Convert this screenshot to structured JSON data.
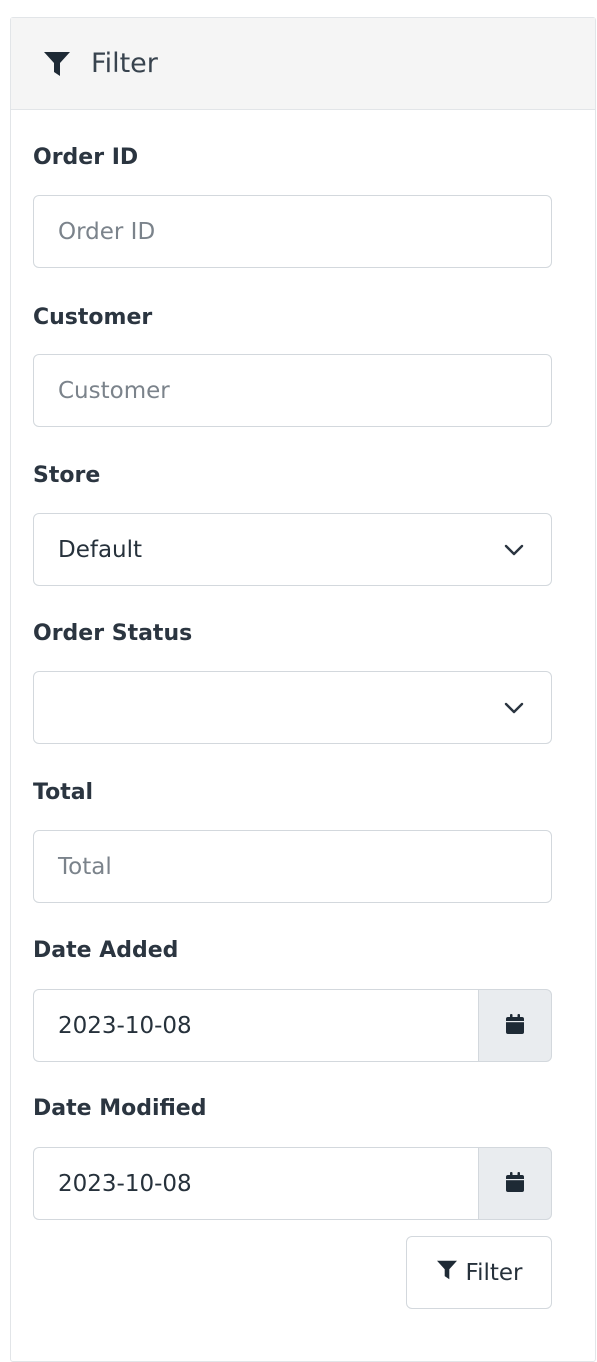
{
  "header": {
    "title": "Filter",
    "icon": "filter-icon"
  },
  "fields": {
    "order_id": {
      "label": "Order ID",
      "placeholder": "Order ID",
      "value": ""
    },
    "customer": {
      "label": "Customer",
      "placeholder": "Customer",
      "value": ""
    },
    "store": {
      "label": "Store",
      "selected": "Default"
    },
    "order_status": {
      "label": "Order Status",
      "selected": ""
    },
    "total": {
      "label": "Total",
      "placeholder": "Total",
      "value": ""
    },
    "date_added": {
      "label": "Date Added",
      "value": "2023-10-08",
      "icon": "calendar-icon"
    },
    "date_modified": {
      "label": "Date Modified",
      "value": "2023-10-08",
      "icon": "calendar-icon"
    }
  },
  "actions": {
    "filter_label": "Filter",
    "filter_icon": "filter-icon"
  },
  "colors": {
    "header_bg": "#f5f5f5",
    "addon_bg": "#e9ecef",
    "border": "#d3d8dd"
  }
}
